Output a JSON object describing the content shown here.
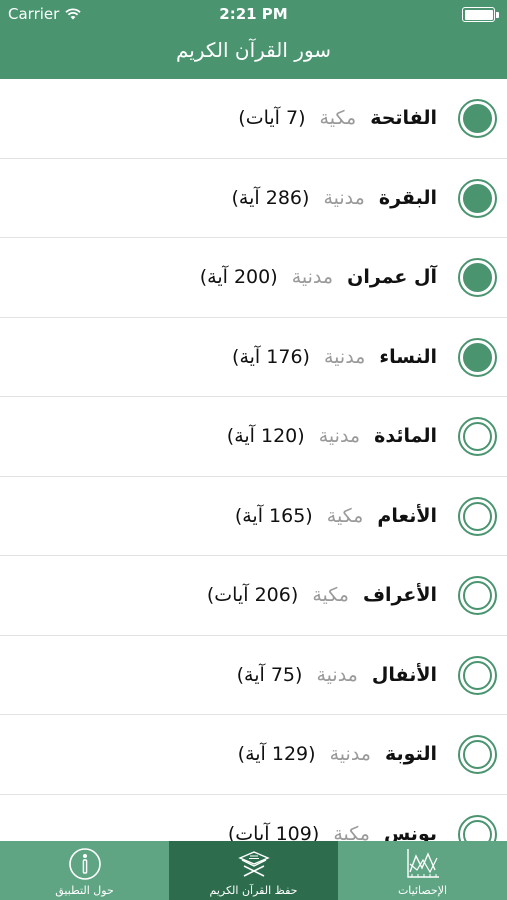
{
  "status_bar": {
    "carrier": "Carrier",
    "time": "2:21 PM"
  },
  "nav": {
    "title": "سور القرآن الكريم"
  },
  "colors": {
    "brand": "#4a9470",
    "tabbar": "#5fa583",
    "tab_active": "#2d6d4d"
  },
  "suras": [
    {
      "name": "الفاتحة",
      "place": "مكية",
      "count": "(7 آيات)",
      "memorized": true
    },
    {
      "name": "البقرة",
      "place": "مدنية",
      "count": "(286 آية)",
      "memorized": true
    },
    {
      "name": "آل عمران",
      "place": "مدنية",
      "count": "(200 آية)",
      "memorized": true
    },
    {
      "name": "النساء",
      "place": "مدنية",
      "count": "(176 آية)",
      "memorized": true
    },
    {
      "name": "المائدة",
      "place": "مدنية",
      "count": "(120 آية)",
      "memorized": false
    },
    {
      "name": "الأنعام",
      "place": "مكية",
      "count": "(165 آية)",
      "memorized": false
    },
    {
      "name": "الأعراف",
      "place": "مكية",
      "count": "(206 آيات)",
      "memorized": false
    },
    {
      "name": "الأنفال",
      "place": "مدنية",
      "count": "(75 آية)",
      "memorized": false
    },
    {
      "name": "التوبة",
      "place": "مدنية",
      "count": "(129 آية)",
      "memorized": false
    },
    {
      "name": "يونس",
      "place": "مكية",
      "count": "(109 آيات)",
      "memorized": false
    }
  ],
  "tabs": [
    {
      "label": "حول التطبيق",
      "icon": "info-icon",
      "active": false
    },
    {
      "label": "حفظ القرآن الكريم",
      "icon": "quran-stand-icon",
      "active": true
    },
    {
      "label": "الإحصائيات",
      "icon": "chart-icon",
      "active": false
    }
  ]
}
